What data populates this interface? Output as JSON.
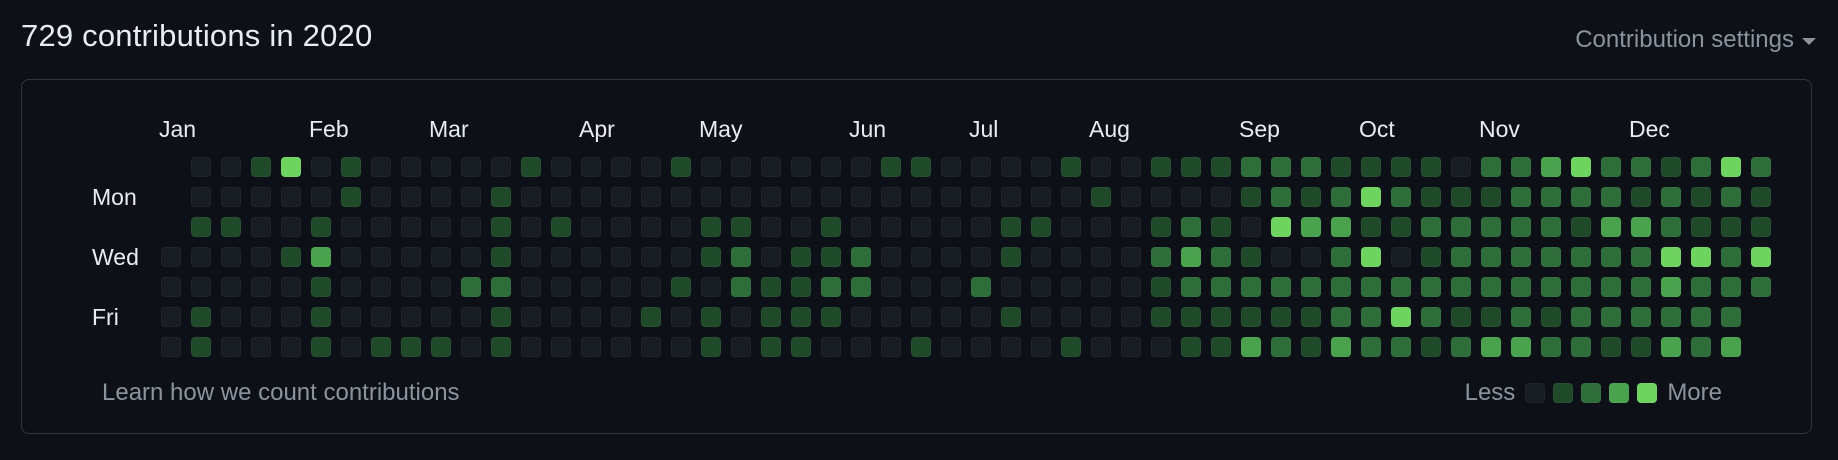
{
  "header": {
    "title": "729 contributions in 2020",
    "settings_label": "Contribution settings"
  },
  "graph": {
    "colors": [
      "#161b22",
      "#0e4429",
      "#006d32",
      "#26a641",
      "#39d353"
    ],
    "palette_display": [
      "#181c23",
      "#1f4a2a",
      "#2e6d3a",
      "#4aa24f",
      "#6ed45f"
    ],
    "months": [
      {
        "label": "Jan",
        "week": 0
      },
      {
        "label": "Feb",
        "week": 5
      },
      {
        "label": "Mar",
        "week": 9
      },
      {
        "label": "Apr",
        "week": 14
      },
      {
        "label": "May",
        "week": 18
      },
      {
        "label": "Jun",
        "week": 23
      },
      {
        "label": "Jul",
        "week": 27
      },
      {
        "label": "Aug",
        "week": 31
      },
      {
        "label": "Sep",
        "week": 36
      },
      {
        "label": "Oct",
        "week": 40
      },
      {
        "label": "Nov",
        "week": 44
      },
      {
        "label": "Dec",
        "week": 49
      }
    ],
    "days": [
      {
        "label": "Mon",
        "row": 1
      },
      {
        "label": "Wed",
        "row": 3
      },
      {
        "label": "Fri",
        "row": 5
      }
    ],
    "levels": [
      "00000000000000000000000000000000000000000000000000000",
      "000000000000000000000000000000000000000000000000000000",
      "000000000000000000000000000000000000000000000000000000",
      "000000000000000000000000000000000000000000000000000000",
      "000000000000000000000000000000000000000000000000000000",
      "000000000000000000000000000000000000000000000000000000",
      "000000000000000000000000000000000000000000000000000000"
    ],
    "contribution_levels": [
      "00014010000010000100000011000010011122211110223422124231",
      "00000010000100000000000000000001000012124211122221212111",
      "01100100000101000011001000001100012104331122222133211121",
      "00001300000100000012011200001000023210024012222222442420",
      "00000100002200000102112200020000012222222222222222322244",
      "01000100000100001010111000001000011111122421121222222120",
      "0100010111010000001011000100001000113213221233221132322432"
    ]
  },
  "footer": {
    "learn_label": "Learn how we count contributions",
    "less_label": "Less",
    "more_label": "More"
  }
}
